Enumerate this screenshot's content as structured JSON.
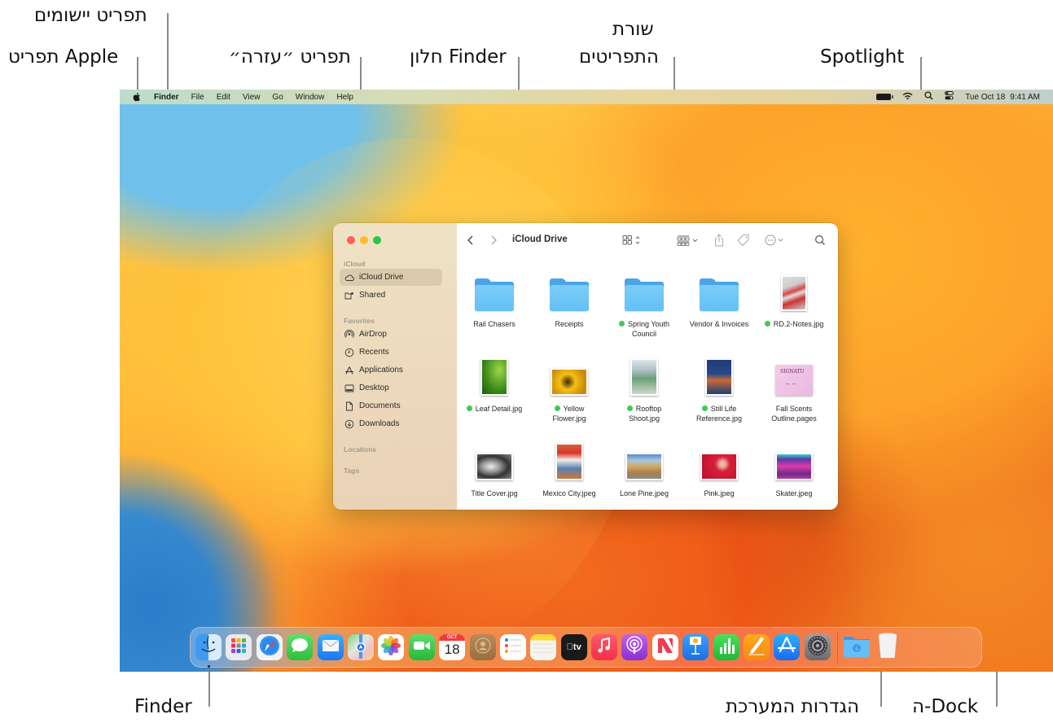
{
  "annotations": {
    "apple_menu": "תפריט Apple",
    "app_menu": "תפריט יישומים",
    "help_menu": "תפריט ״עזרה״",
    "finder_window": "חלון Finder",
    "menu_bar_line1": "שורת",
    "menu_bar_line2": "התפריטים",
    "spotlight": "Spotlight",
    "finder": "Finder",
    "system_settings": "הגדרות המערכת",
    "dock": "ה-Dock"
  },
  "menubar": {
    "apple_icon": "apple-logo-icon",
    "items": [
      "Finder",
      "File",
      "Edit",
      "View",
      "Go",
      "Window",
      "Help"
    ],
    "status_icons": [
      "battery-icon",
      "wifi-icon",
      "spotlight-search-icon",
      "control-center-icon"
    ],
    "date": "Tue Oct 18",
    "time": "9:41 AM"
  },
  "finder": {
    "title": "iCloud Drive",
    "traffic_lights": {
      "close": "#fe5f57",
      "minimize": "#febc2e",
      "zoom": "#28c840"
    },
    "sidebar": {
      "sections": [
        {
          "title": "iCloud",
          "items": [
            {
              "label": "iCloud Drive",
              "icon": "cloud-icon",
              "active": true
            },
            {
              "label": "Shared",
              "icon": "shared-folder-icon",
              "active": false
            }
          ]
        },
        {
          "title": "Favorites",
          "items": [
            {
              "label": "AirDrop",
              "icon": "airdrop-icon"
            },
            {
              "label": "Recents",
              "icon": "clock-icon"
            },
            {
              "label": "Applications",
              "icon": "applications-icon"
            },
            {
              "label": "Desktop",
              "icon": "desktop-icon"
            },
            {
              "label": "Documents",
              "icon": "document-icon"
            },
            {
              "label": "Downloads",
              "icon": "download-icon"
            }
          ]
        },
        {
          "title": "Locations",
          "items": []
        },
        {
          "title": "Tags",
          "items": []
        }
      ]
    },
    "toolbar": [
      "back-icon",
      "forward-icon",
      "icon-view-icon",
      "group-icon",
      "share-icon",
      "tag-icon",
      "more-actions-icon",
      "search-icon"
    ],
    "tag_color": "#3fc957",
    "files": [
      {
        "name": "Rail Chasers",
        "kind": "folder",
        "tagged": false
      },
      {
        "name": "Receipts",
        "kind": "folder",
        "tagged": false
      },
      {
        "name": "Spring Youth Council",
        "kind": "folder",
        "tagged": true
      },
      {
        "name": "Vendor & Invoices",
        "kind": "folder",
        "tagged": false
      },
      {
        "name": "RD.2-Notes.jpg",
        "kind": "image",
        "tagged": true
      },
      {
        "name": "Leaf Detail.jpg",
        "kind": "image",
        "tagged": true
      },
      {
        "name": "Yellow Flower.jpg",
        "kind": "image",
        "tagged": true
      },
      {
        "name": "Rooftop Shoot.jpg",
        "kind": "image",
        "tagged": true
      },
      {
        "name": "Still Life Reference.jpg",
        "kind": "image",
        "tagged": true
      },
      {
        "name": "Fall Scents Outline.pages",
        "kind": "document",
        "tagged": false
      },
      {
        "name": "Title Cover.jpg",
        "kind": "image",
        "tagged": false
      },
      {
        "name": "Mexico City.jpeg",
        "kind": "image",
        "tagged": false
      },
      {
        "name": "Lone Pine.jpeg",
        "kind": "image",
        "tagged": false
      },
      {
        "name": "Pink.jpeg",
        "kind": "image",
        "tagged": false
      },
      {
        "name": "Skater.jpeg",
        "kind": "image",
        "tagged": false
      }
    ]
  },
  "dock": {
    "apps": [
      {
        "name": "Finder",
        "icon": "finder-icon",
        "running": true
      },
      {
        "name": "Launchpad",
        "icon": "launchpad-icon"
      },
      {
        "name": "Safari",
        "icon": "safari-icon"
      },
      {
        "name": "Messages",
        "icon": "messages-icon"
      },
      {
        "name": "Mail",
        "icon": "mail-icon"
      },
      {
        "name": "Maps",
        "icon": "maps-icon"
      },
      {
        "name": "Photos",
        "icon": "photos-icon"
      },
      {
        "name": "FaceTime",
        "icon": "facetime-icon"
      },
      {
        "name": "Calendar",
        "icon": "calendar-icon",
        "month": "OCT",
        "day": "18"
      },
      {
        "name": "Contacts",
        "icon": "contacts-icon"
      },
      {
        "name": "Reminders",
        "icon": "reminders-icon"
      },
      {
        "name": "Notes",
        "icon": "notes-icon"
      },
      {
        "name": "TV",
        "icon": "apple-tv-icon",
        "text": "tv"
      },
      {
        "name": "Music",
        "icon": "music-icon"
      },
      {
        "name": "Podcasts",
        "icon": "podcasts-icon"
      },
      {
        "name": "News",
        "icon": "news-icon"
      },
      {
        "name": "Keynote",
        "icon": "keynote-icon"
      },
      {
        "name": "Numbers",
        "icon": "numbers-icon"
      },
      {
        "name": "Pages",
        "icon": "pages-icon"
      },
      {
        "name": "App Store",
        "icon": "app-store-icon"
      },
      {
        "name": "System Settings",
        "icon": "system-settings-icon"
      }
    ],
    "stacks": [
      {
        "name": "Downloads",
        "icon": "downloads-folder-icon"
      },
      {
        "name": "Trash",
        "icon": "trash-icon"
      }
    ]
  }
}
